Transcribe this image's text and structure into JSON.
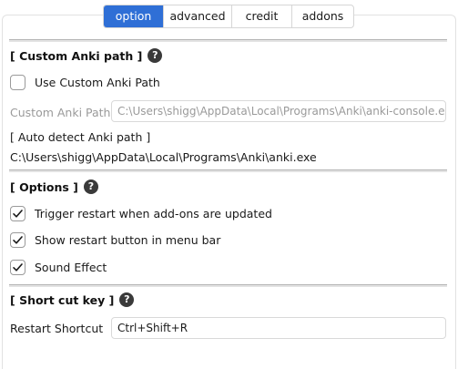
{
  "tabs": [
    {
      "label": "option",
      "active": true
    },
    {
      "label": "advanced",
      "active": false
    },
    {
      "label": "credit",
      "active": false
    },
    {
      "label": "addons",
      "active": false
    }
  ],
  "custom_anki_path": {
    "heading": "[ Custom Anki path ]",
    "help_icon": "?",
    "use_custom_label": "Use Custom Anki Path",
    "use_custom_checked": false,
    "path_label": "Custom Anki Path",
    "path_value": "C:\\Users\\shigg\\AppData\\Local\\Programs\\Anki\\anki-console.exe",
    "auto_detect_label": "[ Auto detect Anki path ]",
    "auto_detect_value": "C:\\Users\\shigg\\AppData\\Local\\Programs\\Anki\\anki.exe"
  },
  "options": {
    "heading": "[ Options ]",
    "help_icon": "?",
    "items": [
      {
        "label": "Trigger restart when add-ons are updated",
        "checked": true
      },
      {
        "label": "Show restart button in menu bar",
        "checked": true
      },
      {
        "label": "Sound Effect",
        "checked": true
      }
    ]
  },
  "shortcut": {
    "heading": "[ Short cut key ]",
    "help_icon": "?",
    "label": "Restart Shortcut",
    "value": "Ctrl+Shift+R"
  },
  "colors": {
    "accent": "#2f6fd6",
    "help_icon_bg": "#3a3a3a",
    "muted_text": "#9a9a9a"
  }
}
